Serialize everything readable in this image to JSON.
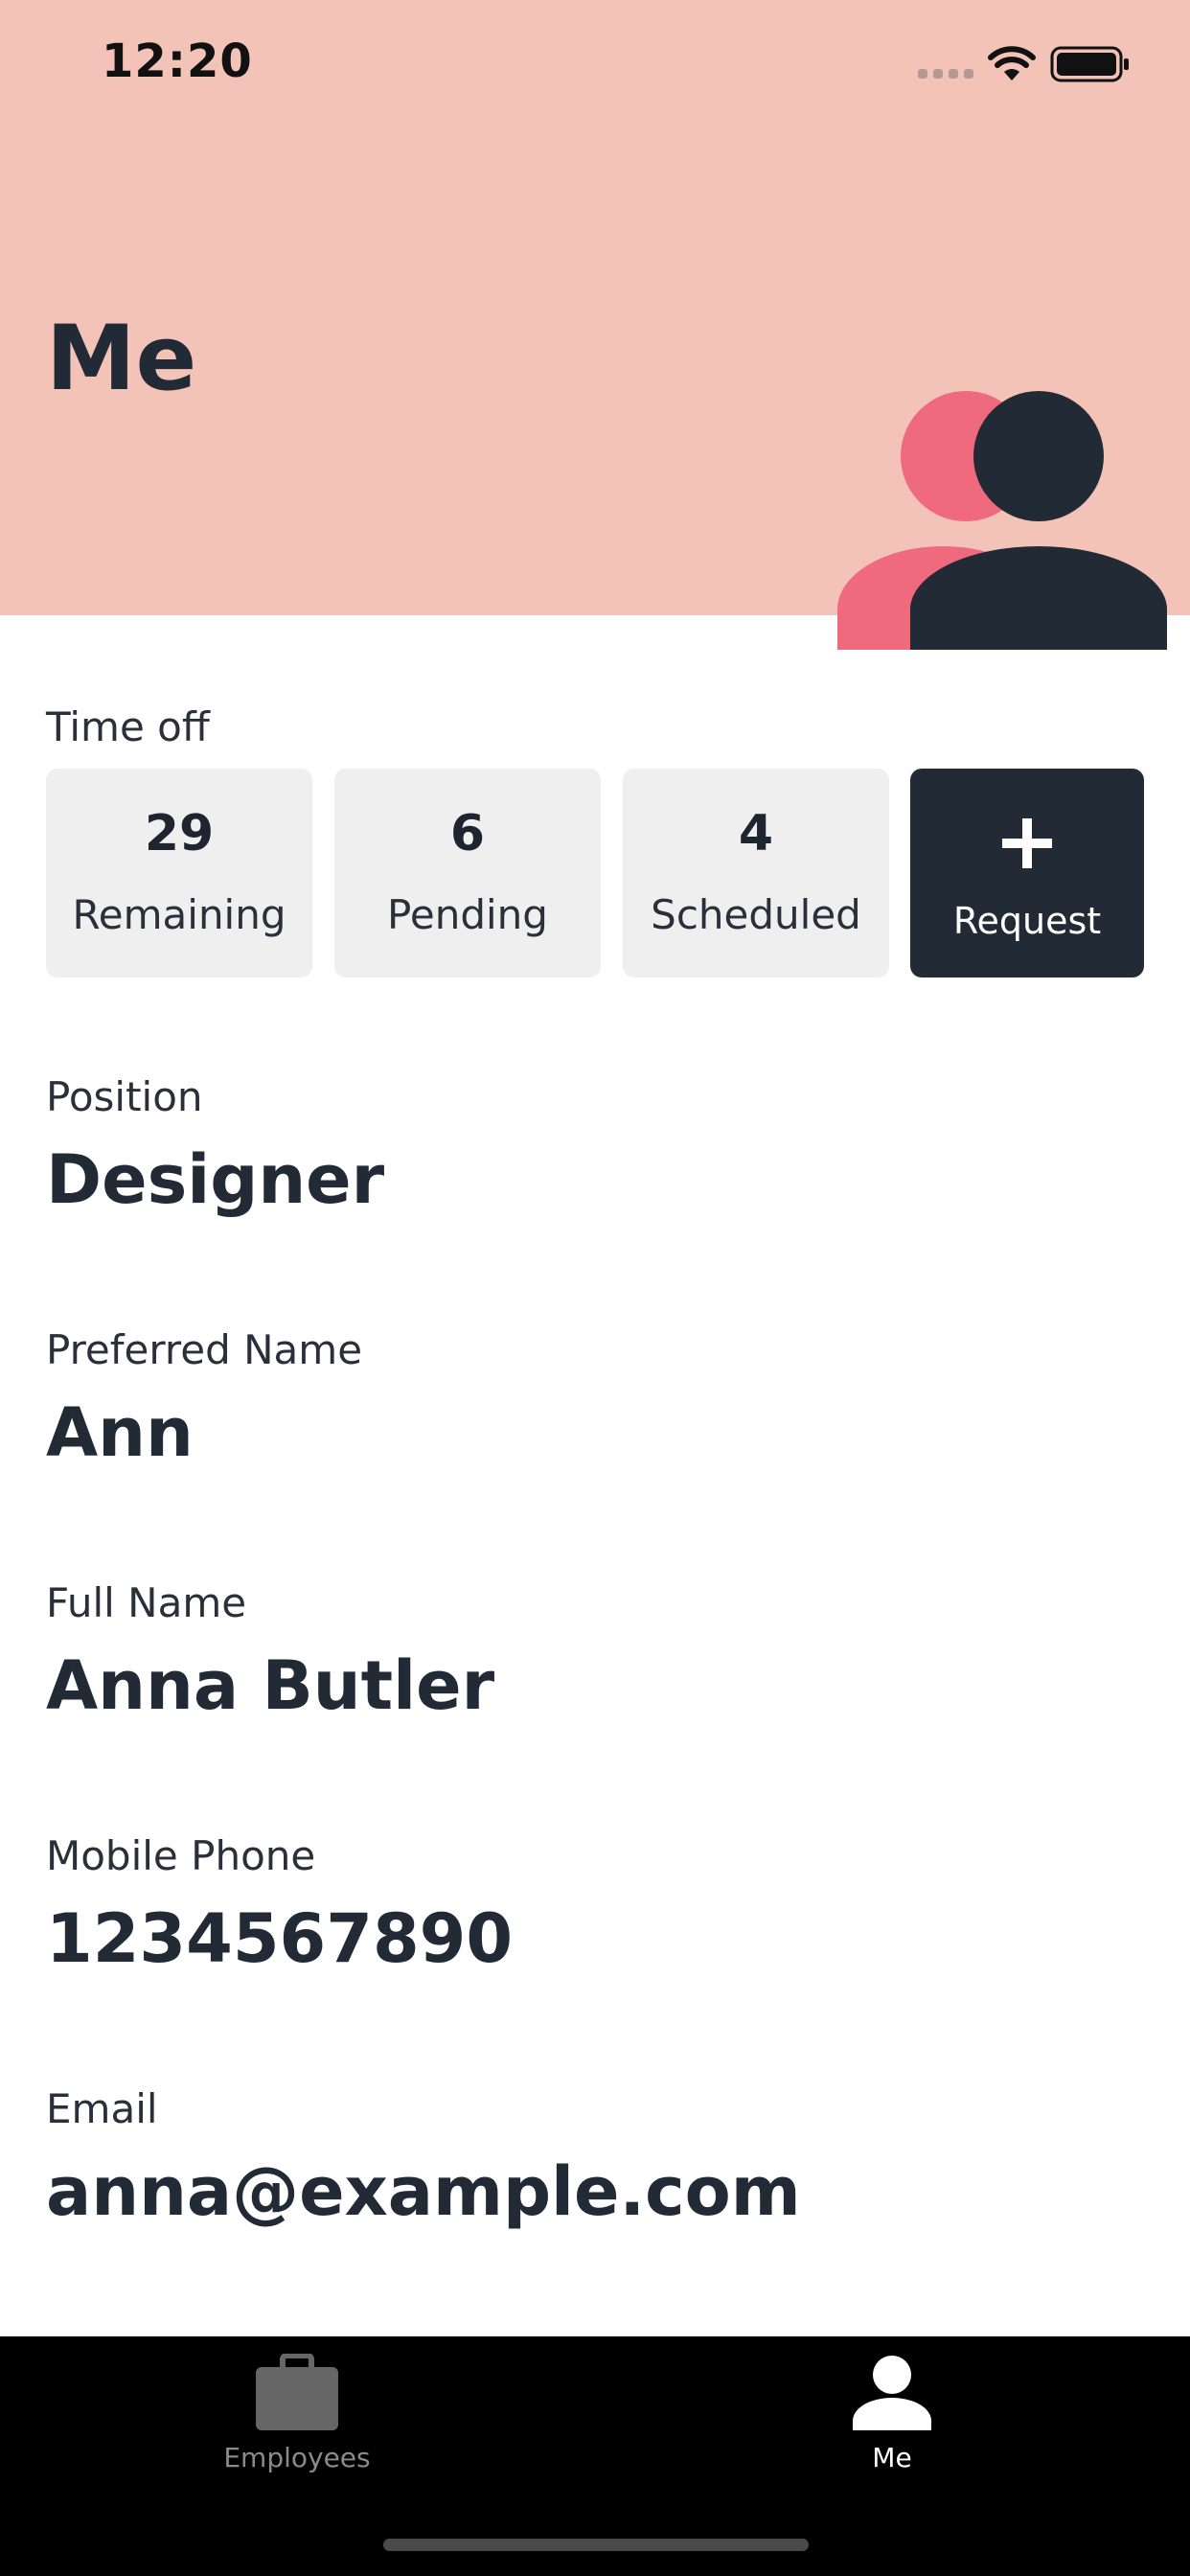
{
  "status_bar": {
    "time": "12:20"
  },
  "header": {
    "title": "Me"
  },
  "time_off": {
    "label": "Time off",
    "remaining": {
      "count": "29",
      "label": "Remaining"
    },
    "pending": {
      "count": "6",
      "label": "Pending"
    },
    "scheduled": {
      "count": "4",
      "label": "Scheduled"
    },
    "request": {
      "label": "Request"
    }
  },
  "fields": {
    "position": {
      "label": "Position",
      "value": "Designer"
    },
    "preferred_name": {
      "label": "Preferred Name",
      "value": "Ann"
    },
    "full_name": {
      "label": "Full Name",
      "value": "Anna Butler"
    },
    "mobile_phone": {
      "label": "Mobile Phone",
      "value": "1234567890"
    },
    "email": {
      "label": "Email",
      "value": "anna@example.com"
    }
  },
  "tabbar": {
    "employees": {
      "label": "Employees",
      "icon": "briefcase-icon",
      "active": false
    },
    "me": {
      "label": "Me",
      "icon": "person-icon",
      "active": true
    }
  },
  "colors": {
    "header_bg": "#f3c3b7",
    "dark": "#222a36",
    "accent_pink": "#ef6a7d",
    "card_bg": "#efefef"
  }
}
